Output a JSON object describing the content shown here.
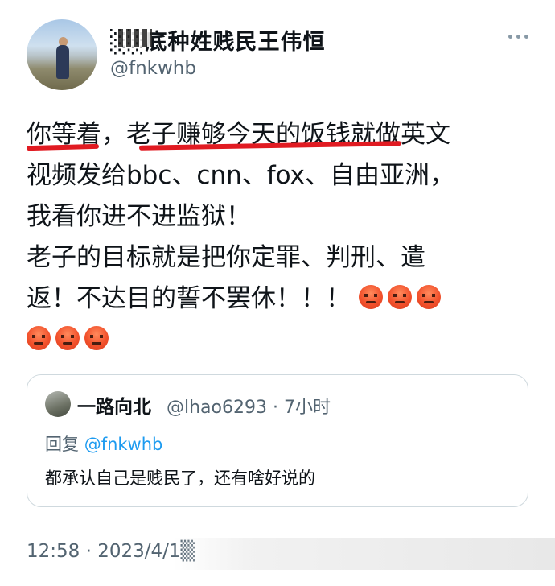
{
  "author": {
    "display_name": "░░底种姓贱民王伟恒",
    "handle": "@fnkwhb"
  },
  "tweet": {
    "lines": [
      "你等着，老子赚够今天的饭钱就做英文",
      "视频发给bbc、cnn、fox、自由亚洲，",
      "我看你进不进监狱！",
      "老子的目标就是把你定罪、判刑、遣",
      "返！不达目的誓不罢休！！！"
    ],
    "emoji": [
      "pouting-face",
      "pouting-face",
      "pouting-face",
      "pouting-face",
      "pouting-face",
      "pouting-face"
    ]
  },
  "quote": {
    "name": "一路向北",
    "meta": "@lhao6293 · 7小时",
    "reply_prefix": "回复",
    "reply_handle": "@fnkwhb",
    "text": "都承认自己是贱民了，还有啥好说的"
  },
  "timestamp": "12:58 · 2023/4/1▒",
  "colors": {
    "text": "#0f1419",
    "secondary": "#536471",
    "link": "#1d9bf0",
    "underline": "#e11b22",
    "border": "#cfd9de"
  }
}
